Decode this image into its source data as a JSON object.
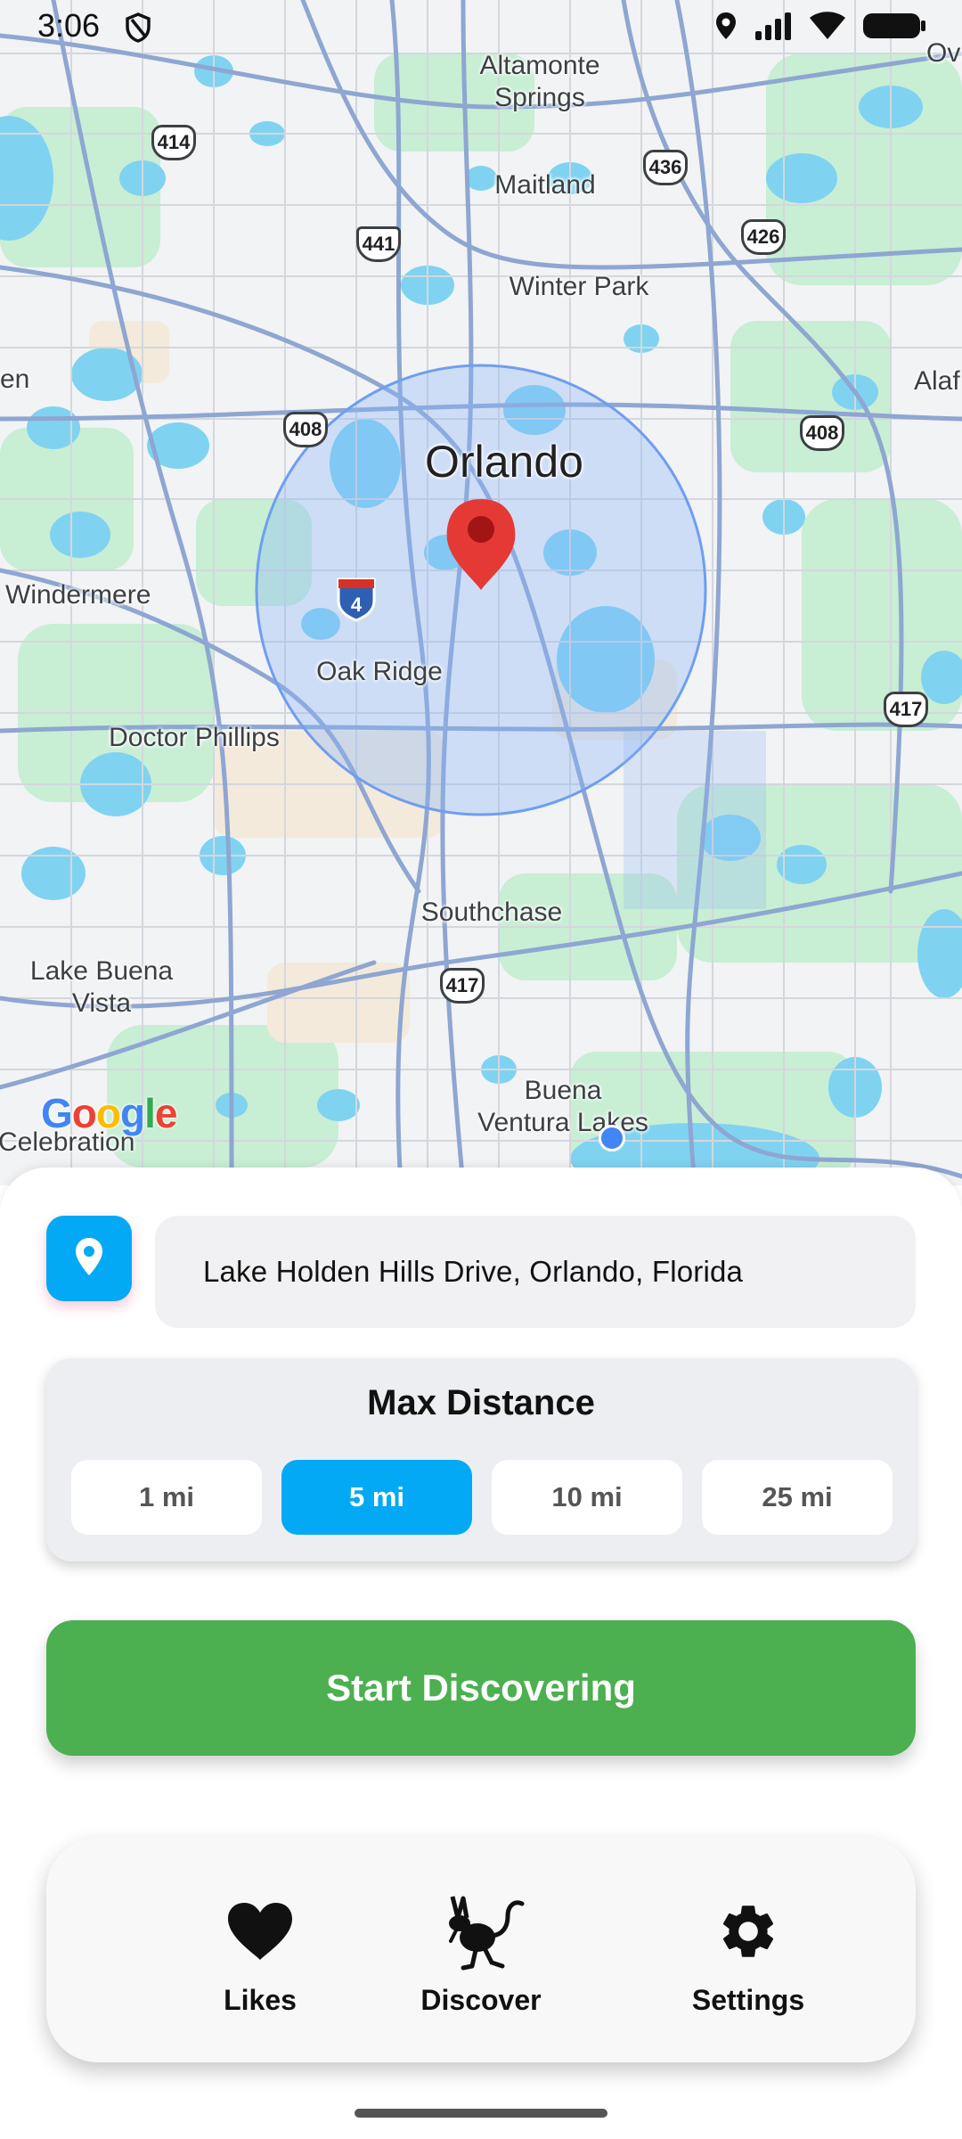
{
  "status_bar": {
    "time": "3:06",
    "icons": [
      "shield-icon",
      "location-icon",
      "signal-icon",
      "wifi-icon",
      "battery-icon"
    ]
  },
  "map": {
    "labels": {
      "altamonte": "Altamonte\nSprings",
      "maitland": "Maitland",
      "winter_park": "Winter Park",
      "orlando": "Orlando",
      "windermere": "Windermere",
      "oak_ridge": "Oak Ridge",
      "doctor_phillips": "Doctor Phillips",
      "southchase": "Southchase",
      "lake_buena_vista": "Lake Buena\nVista",
      "buena_ventura_lakes": "Buena\nVentura Lakes",
      "celebration": "Celebration",
      "alaf": "Alaf",
      "ovi": "Ovi",
      "en": "en"
    },
    "shields": {
      "r414": "414",
      "r436": "436",
      "r441": "441",
      "r426": "426",
      "r408a": "408",
      "r408b": "408",
      "i4": "4",
      "r417a": "417",
      "r417b": "417"
    },
    "attribution": "Google",
    "accent_color": "#4285f4",
    "pin_color": "#e53935"
  },
  "location": {
    "address": "Lake Holden Hills Drive, Orlando, Florida",
    "button_icon": "map-pin-icon"
  },
  "distance": {
    "title": "Max Distance",
    "options": [
      "1 mi",
      "5 mi",
      "10 mi",
      "25 mi"
    ],
    "selected": "5 mi",
    "selected_color": "#03a9f4"
  },
  "start_button": {
    "label": "Start Discovering",
    "color": "#4caf50"
  },
  "nav": {
    "likes": {
      "label": "Likes",
      "icon": "heart-icon"
    },
    "discover": {
      "label": "Discover",
      "icon": "jerboa-icon"
    },
    "settings": {
      "label": "Settings",
      "icon": "gear-icon"
    }
  }
}
